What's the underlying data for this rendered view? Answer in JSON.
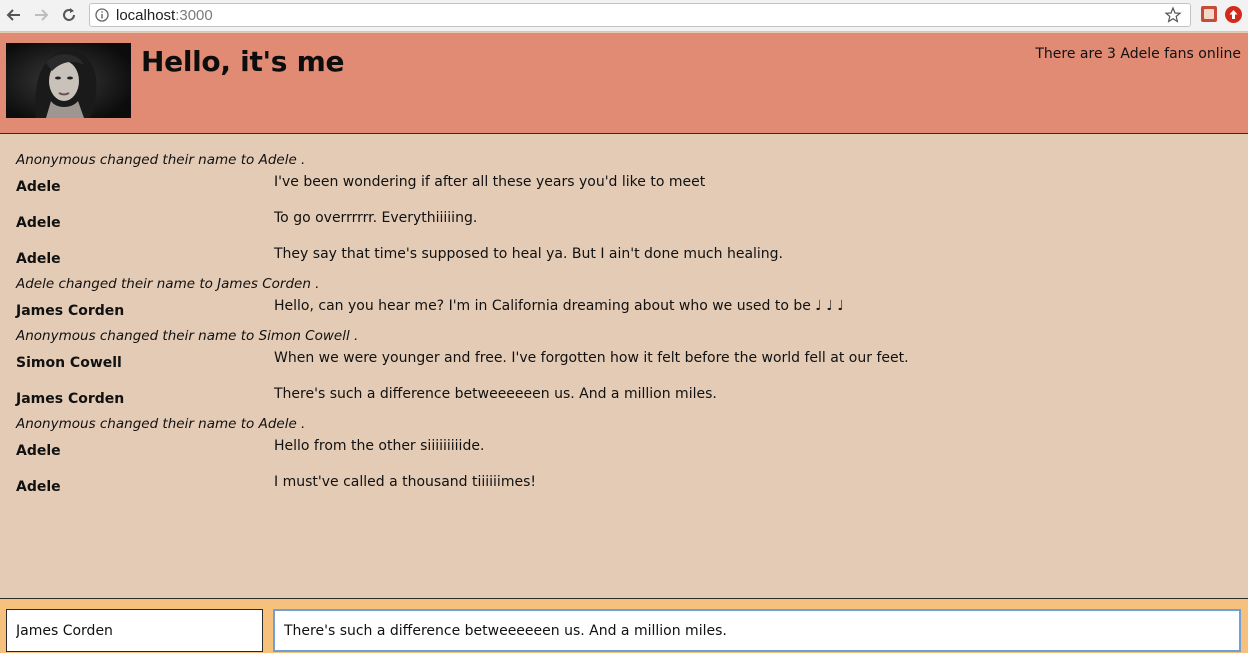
{
  "browser": {
    "url_host": "localhost",
    "url_port": ":3000"
  },
  "header": {
    "title": "Hello, it's me",
    "online_text": "There are 3 Adele fans online",
    "background_color": "#e18a74"
  },
  "messages": [
    {
      "type": "system",
      "text": "Anonymous changed their name to Adele ."
    },
    {
      "type": "chat",
      "author": "Adele",
      "text": "I've been wondering if after all these years you'd like to meet"
    },
    {
      "type": "chat",
      "author": "Adele",
      "text": "To go overrrrrr. Everythiiiiing."
    },
    {
      "type": "chat",
      "author": "Adele",
      "text": "They say that time's supposed to heal ya. But I ain't done much healing."
    },
    {
      "type": "system",
      "text": "Adele changed their name to James Corden ."
    },
    {
      "type": "chat",
      "author": "James Corden",
      "text": "Hello, can you hear me? I'm in California dreaming about who we used to be ♩ ♩ ♩"
    },
    {
      "type": "system",
      "text": "Anonymous changed their name to Simon Cowell ."
    },
    {
      "type": "chat",
      "author": "Simon Cowell",
      "text": "When we were younger and free. I've forgotten how it felt before the world fell at our feet."
    },
    {
      "type": "chat",
      "author": "James Corden",
      "text": "There's such a difference betweeeeeen us. And a million miles."
    },
    {
      "type": "system",
      "text": "Anonymous changed their name to Adele ."
    },
    {
      "type": "chat",
      "author": "Adele",
      "text": "Hello from the other siiiiiiiiide."
    },
    {
      "type": "chat",
      "author": "Adele",
      "text": "I must've called a thousand tiiiiiimes!"
    }
  ],
  "footer": {
    "name_value": "James Corden",
    "message_value": "There's such a difference betweeeeeen us. And a million miles.",
    "background_color": "#f5c17c"
  }
}
